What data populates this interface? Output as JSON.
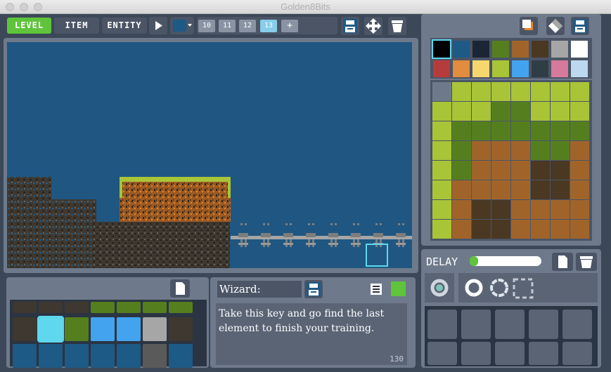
{
  "window": {
    "title": "Golden8Bits"
  },
  "toolbar": {
    "level_label": "LEVEL",
    "item_label": "ITEM",
    "entity_label": "ENTITY",
    "level_tabs": [
      "10",
      "11",
      "12",
      "13",
      "+"
    ],
    "active_level": "13",
    "color_swatch": "#1e5a86"
  },
  "palette": {
    "colors": [
      "#000000",
      "#1e5a86",
      "#1b2535",
      "#557f1f",
      "#a0642a",
      "#4a3822",
      "#a6a6a6",
      "#ffffff",
      "#b63c3c",
      "#e18c3e",
      "#f5d76e",
      "#a9c437",
      "#44a3ee",
      "#2f3d46",
      "#d6799a",
      "#bcd8ef"
    ],
    "selected_index": 0
  },
  "dialog": {
    "speaker": "Wizard:",
    "text": "Take this key and go find the last element to finish your training.",
    "char_count": "130",
    "accent": "#5fc43b"
  },
  "animation": {
    "delay_label": "DELAY",
    "delay_fraction": 0.12
  },
  "colors": {
    "accent_green": "#5fc43b",
    "canvas_bg": "#1f5782",
    "panel": "#6e7a8b"
  }
}
